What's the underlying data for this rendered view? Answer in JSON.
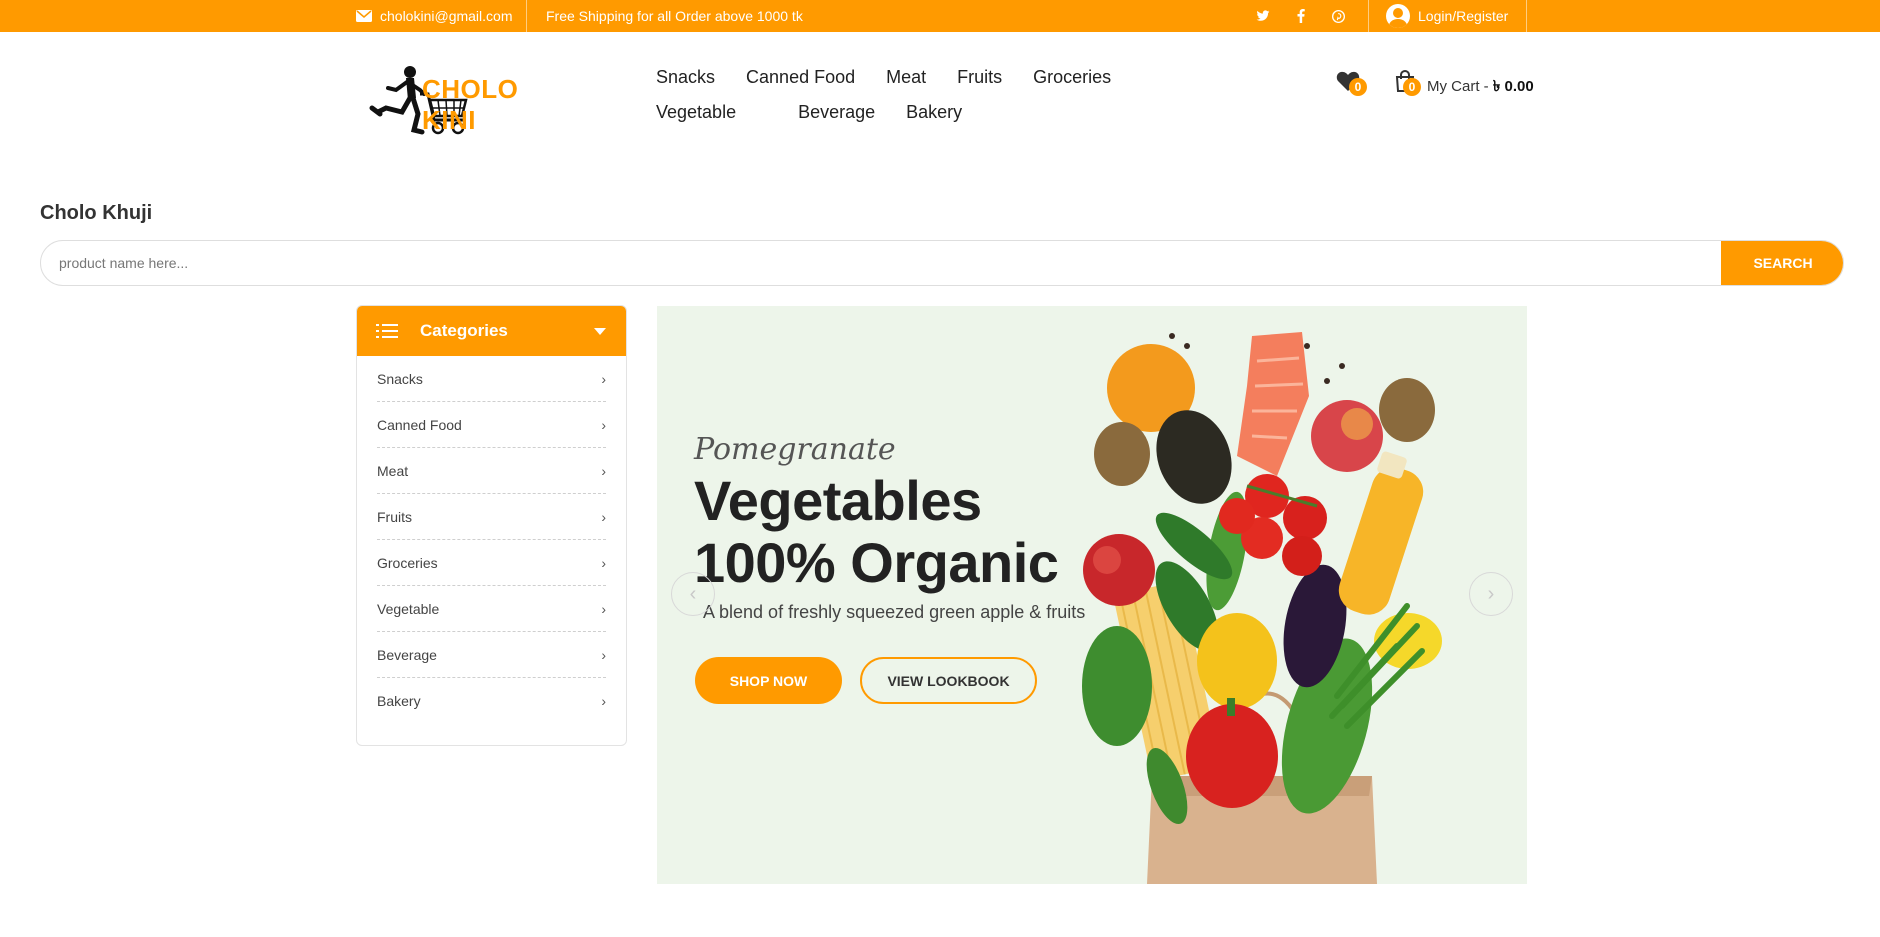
{
  "topbar": {
    "email": "cholokini@gmail.com",
    "shipping": "Free Shipping for all Order above 1000 tk",
    "social": [
      "twitter-icon",
      "facebook-icon",
      "pinterest-icon"
    ],
    "login": "Login/Register"
  },
  "logo": {
    "text": "CHOLO KINI"
  },
  "nav": [
    "Snacks",
    "Canned Food",
    "Meat",
    "Fruits",
    "Groceries",
    "Vegetable",
    "Beverage",
    "Bakery"
  ],
  "wishlist": {
    "count": "0"
  },
  "cart": {
    "count": "0",
    "label": "My Cart - ",
    "total": "৳ 0.00"
  },
  "search": {
    "title": "Cholo Khuji",
    "placeholder": "product name here...",
    "button": "SEARCH"
  },
  "categories": {
    "title": "Categories",
    "items": [
      "Snacks",
      "Canned Food",
      "Meat",
      "Fruits",
      "Groceries",
      "Vegetable",
      "Beverage",
      "Bakery"
    ]
  },
  "hero": {
    "subtitle": "Pomegranate",
    "title_line1": "Vegetables",
    "title_line2": "100% Organic",
    "description": "A blend of freshly squeezed green apple & fruits",
    "primary_button": "SHOP NOW",
    "secondary_button": "VIEW LOOKBOOK"
  },
  "colors": {
    "accent": "#ff9a00",
    "hero_bg": "#edf5ea"
  }
}
